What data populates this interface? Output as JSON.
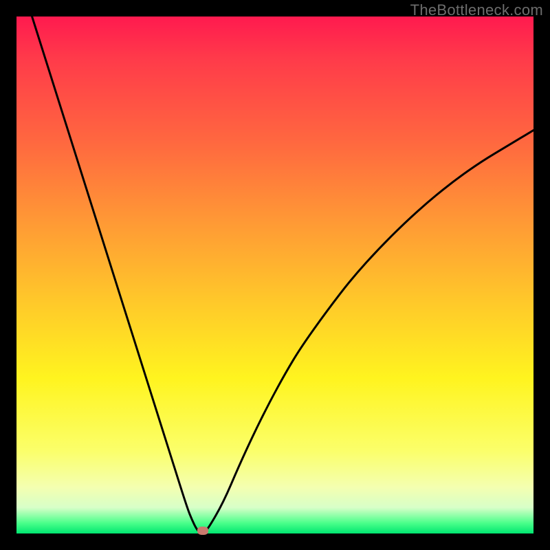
{
  "watermark": "TheBottleneck.com",
  "chart_data": {
    "type": "line",
    "title": "",
    "xlabel": "",
    "ylabel": "",
    "xlim": [
      0,
      100
    ],
    "ylim": [
      0,
      100
    ],
    "x": [
      3,
      6,
      9,
      12,
      15,
      18,
      21,
      24,
      27,
      30,
      33,
      34,
      35,
      36,
      37,
      40,
      43,
      46,
      49,
      52,
      55,
      60,
      65,
      70,
      75,
      80,
      85,
      90,
      95,
      100
    ],
    "values": [
      100,
      90.5,
      81,
      71.5,
      62,
      52.5,
      43,
      33.5,
      24,
      14.5,
      5,
      2.5,
      0.5,
      0,
      0.8,
      6,
      13,
      19.5,
      25.5,
      31,
      36,
      43,
      49.5,
      55,
      60,
      64.5,
      68.5,
      72,
      75,
      78
    ],
    "minimum_marker": {
      "x": 36,
      "y": 0
    },
    "gradient_stops": [
      {
        "pos": 0,
        "color": "#ff1a4f"
      },
      {
        "pos": 40,
        "color": "#ff9a35"
      },
      {
        "pos": 70,
        "color": "#fff41f"
      },
      {
        "pos": 95,
        "color": "#d7ffc8"
      },
      {
        "pos": 100,
        "color": "#00e670"
      }
    ]
  }
}
